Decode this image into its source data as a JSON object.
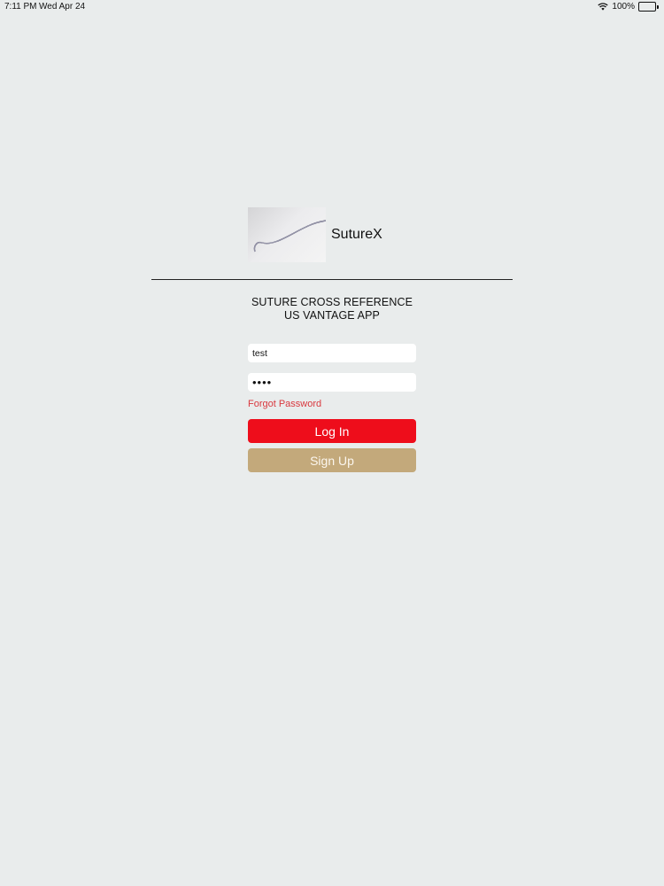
{
  "status_bar": {
    "time": "7:11 PM",
    "date": "Wed Apr 24",
    "battery": "100%"
  },
  "app": {
    "name": "SutureX",
    "subtitle_line1": "SUTURE CROSS REFERENCE",
    "subtitle_line2": "US VANTAGE APP"
  },
  "login_form": {
    "username_value": "test",
    "password_value": "test",
    "forgot_password_label": "Forgot Password",
    "login_label": "Log In",
    "signup_label": "Sign Up"
  },
  "colors": {
    "background": "#e9ecec",
    "login_button": "#ee0d1b",
    "signup_button": "#c3a97b",
    "forgot_link": "#d9383e"
  },
  "icons": {
    "wifi": "wifi-icon",
    "battery": "battery-icon",
    "logo": "suture-logo-image"
  }
}
